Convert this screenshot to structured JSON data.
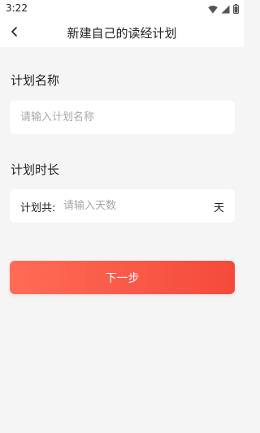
{
  "status_bar": {
    "time": "3:22",
    "icons": [
      "wifi-icon",
      "signal-icon",
      "battery-icon"
    ]
  },
  "app_bar": {
    "back_icon": "chevron-left-icon",
    "title": "新建自己的读经计划"
  },
  "plan_name": {
    "section_title": "计划名称",
    "value": "",
    "placeholder": "请输入计划名称"
  },
  "plan_duration": {
    "section_title": "计划时长",
    "label": "计划共:",
    "value": "",
    "placeholder": "请输入天数",
    "unit": "天"
  },
  "next_button": {
    "label": "下一步"
  },
  "colors": {
    "background": "#f5f5f5",
    "card": "#ffffff",
    "accent_start": "#ff6c55",
    "accent_end": "#f44a3c",
    "placeholder": "#a8a8a8"
  }
}
